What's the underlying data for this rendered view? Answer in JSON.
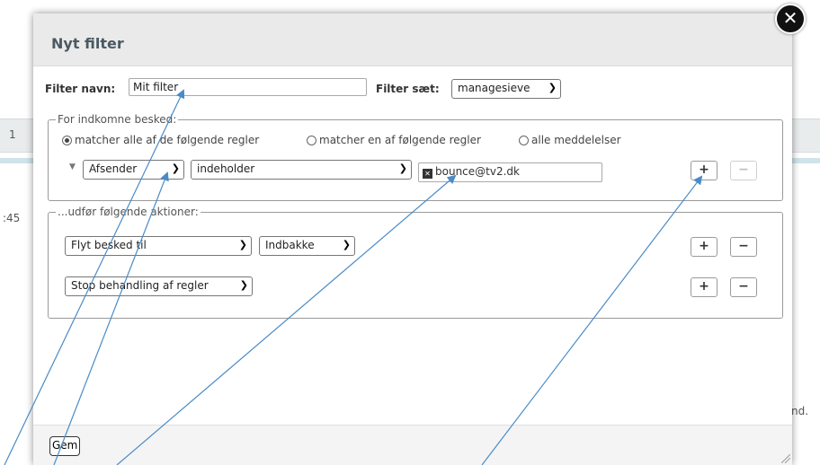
{
  "background": {
    "left_fragment_1": "1",
    "left_fragment_2": ":45",
    "right_fragment": "nd."
  },
  "dialog": {
    "title": "Nyt filter",
    "close_label": "✕",
    "filter_name_label": "Filter navn:",
    "filter_name_value": "Mit filter",
    "filter_set_label": "Filter sæt:",
    "filter_set_value": "managesieve"
  },
  "incoming": {
    "legend": "For indkomne besked:",
    "radio_all": "matcher alle af de følgende regler",
    "radio_any": "matcher en af følgende regler",
    "radio_every": "alle meddelelser",
    "selected": "all",
    "rule": {
      "header_value": "Afsender",
      "operator_value": "indeholder",
      "target_value": "bounce@tv2.dk"
    },
    "add_label": "+",
    "remove_label": "−"
  },
  "actions": {
    "legend": "...udfør følgende aktioner:",
    "rows": [
      {
        "action": "Flyt besked til",
        "folder": "Indbakke",
        "add": "+",
        "remove": "−"
      },
      {
        "action": "Stop behandling af regler",
        "add": "+",
        "remove": "−"
      }
    ]
  },
  "footer": {
    "save_label": "Gem"
  },
  "colors": {
    "arrow": "#4a8bc8",
    "header_bg": "#eaeaea"
  }
}
